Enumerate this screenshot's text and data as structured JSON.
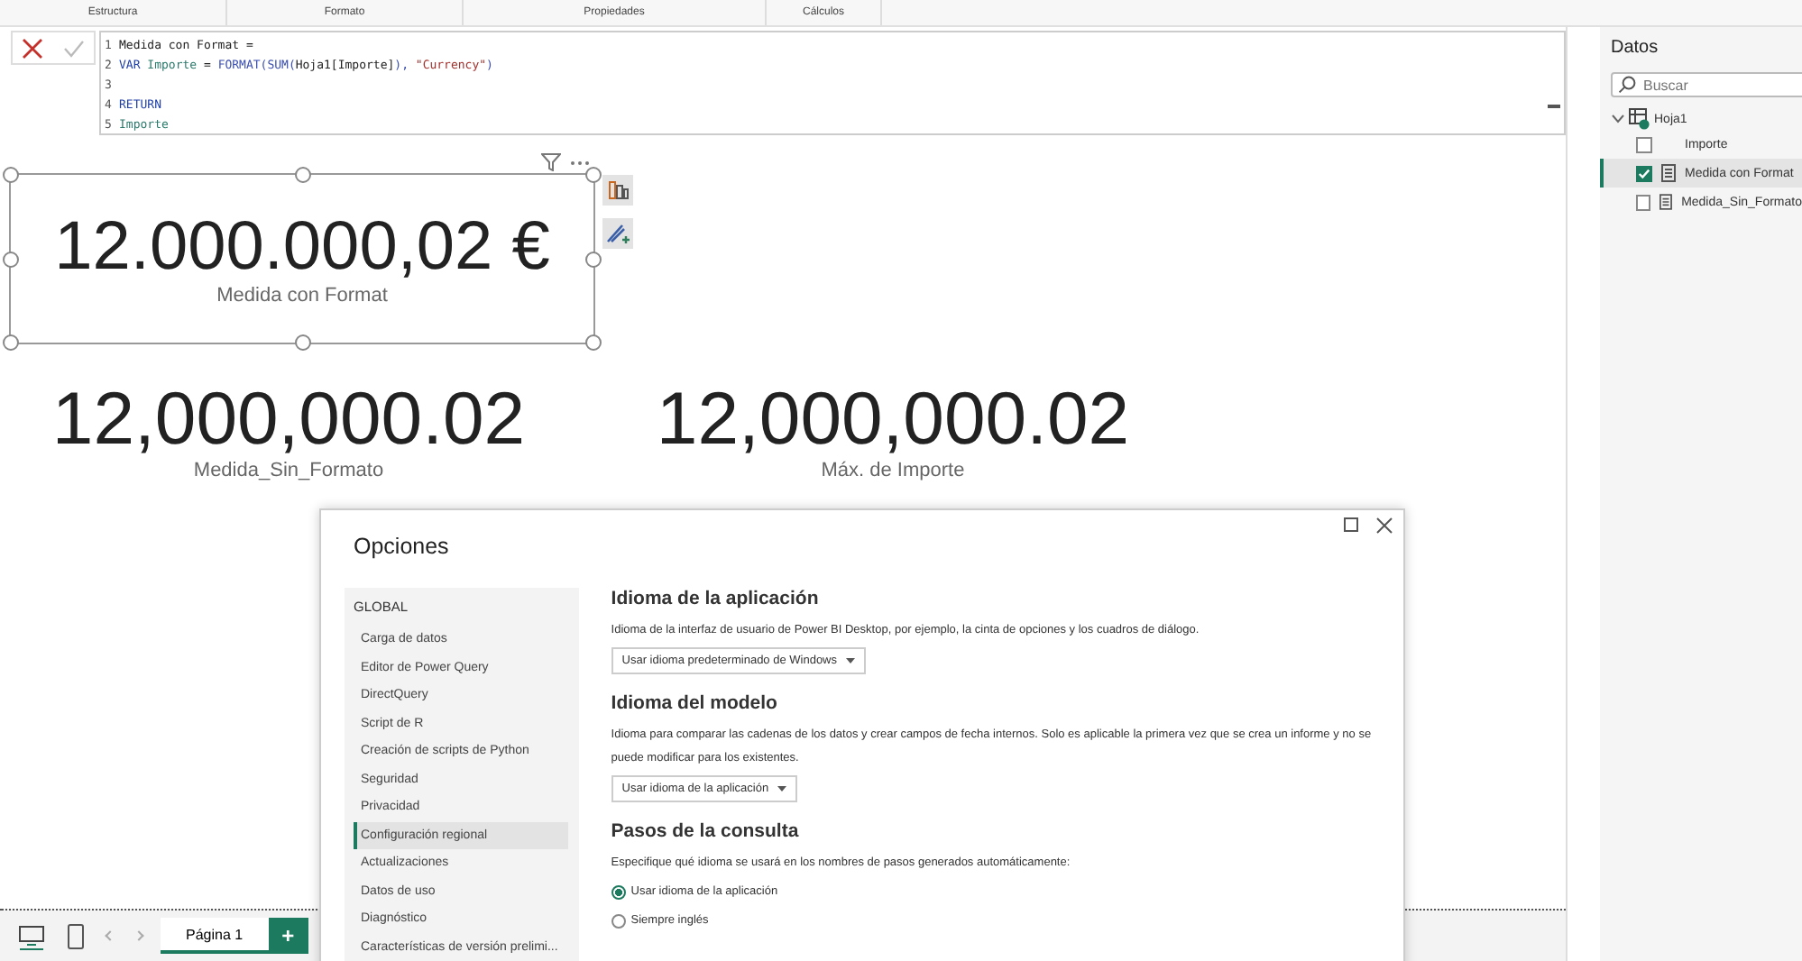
{
  "ribbon_groups": [
    "Estructura",
    "Formato",
    "Propiedades",
    "Cálculos"
  ],
  "formula": {
    "lines": [
      {
        "number": "1",
        "tokens": [
          {
            "kind": "plain",
            "text": "Medida con Format ="
          }
        ]
      },
      {
        "number": "2",
        "tokens": [
          {
            "kind": "keyword",
            "text": "VAR"
          },
          {
            "kind": "var",
            "text": " Importe"
          },
          {
            "kind": "plain",
            "text": " = "
          },
          {
            "kind": "function",
            "text": "FORMAT(SUM("
          },
          {
            "kind": "plain",
            "text": "Hoja1[Importe]"
          },
          {
            "kind": "function",
            "text": "), "
          },
          {
            "kind": "string",
            "text": "\"Currency\""
          },
          {
            "kind": "function",
            "text": ")"
          }
        ]
      },
      {
        "number": "3"
      },
      {
        "number": "4",
        "tokens": [
          {
            "kind": "keyword",
            "text": "RETURN"
          }
        ]
      },
      {
        "number": "5",
        "tokens": [
          {
            "kind": "var",
            "text": "Importe"
          }
        ]
      }
    ]
  },
  "cards": [
    {
      "value": "12.000.000,02 €",
      "label": "Medida con Format",
      "selected": true
    },
    {
      "value": "12,000,000.02",
      "label": "Medida_Sin_Formato",
      "selected": false
    },
    {
      "value": "12,000,000.02",
      "label": "Máx. de Importe",
      "selected": false
    }
  ],
  "data_pane": {
    "title": "Datos",
    "search": {
      "placeholder": "Buscar"
    },
    "table": "Hoja1",
    "fields": [
      {
        "name": "Importe",
        "kind": "column",
        "checked": false,
        "selected": false
      },
      {
        "name": "Medida con Format",
        "kind": "measure",
        "checked": true,
        "selected": true
      },
      {
        "name": "Medida_Sin_Formato",
        "kind": "measure",
        "checked": false,
        "selected": false
      }
    ]
  },
  "pages": {
    "tabs": [
      {
        "label": "Página 1",
        "selected": true
      }
    ],
    "add": "+"
  },
  "dialog": {
    "title": "Opciones",
    "section": "GLOBAL",
    "items": [
      {
        "label": "Carga de datos",
        "selected": false
      },
      {
        "label": "Editor de Power Query",
        "selected": false
      },
      {
        "label": "DirectQuery",
        "selected": false
      },
      {
        "label": "Script de R",
        "selected": false
      },
      {
        "label": "Creación de scripts de Python",
        "selected": false
      },
      {
        "label": "Seguridad",
        "selected": false
      },
      {
        "label": "Privacidad",
        "selected": false
      },
      {
        "label": "Configuración regional",
        "selected": true
      },
      {
        "label": "Actualizaciones",
        "selected": false
      },
      {
        "label": "Datos de uso",
        "selected": false
      },
      {
        "label": "Diagnóstico",
        "selected": false
      },
      {
        "label": "Características de versión prelimi...",
        "selected": false
      }
    ],
    "groups": [
      {
        "heading": "Idioma de la aplicación",
        "description": "Idioma de la interfaz de usuario de Power BI Desktop, por ejemplo, la cinta de opciones y los cuadros de diálogo.",
        "kind": "dropdown",
        "value": "Usar idioma predeterminado de Windows"
      },
      {
        "heading": "Idioma del modelo",
        "description": "Idioma para comparar las cadenas de los datos y crear campos de fecha internos. Solo es aplicable la primera vez que se crea un informe y no se puede modificar para los existentes.",
        "kind": "dropdown",
        "value": "Usar idioma de la aplicación"
      },
      {
        "heading": "Pasos de la consulta",
        "description": "Especifique qué idioma se usará en los nombres de pasos generados automáticamente:",
        "kind": "radio",
        "options": [
          {
            "label": "Usar idioma de la aplicación",
            "selected": true
          },
          {
            "label": "Siempre inglés",
            "selected": false
          }
        ]
      }
    ]
  }
}
